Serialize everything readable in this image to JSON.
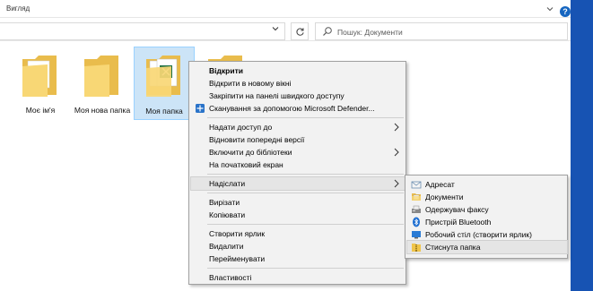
{
  "ribbon": {
    "tab_view": "Вигляд",
    "collapse_icon": "chevron-down-icon",
    "help_label": "?"
  },
  "address_bar": {
    "search_placeholder": "Пошук: Документи"
  },
  "folders": [
    {
      "label": "Моє ім'я",
      "selected": false
    },
    {
      "label": "Моя нова папка",
      "selected": false
    },
    {
      "label": "Моя папка",
      "selected": true
    },
    {
      "label": "",
      "selected": false
    }
  ],
  "context_menu": {
    "items": [
      {
        "label": "Відкрити",
        "bold": true
      },
      {
        "label": "Відкрити в новому вікні"
      },
      {
        "label": "Закріпити на панелі швидкого доступу"
      },
      {
        "label": "Сканування за допомогою Microsoft Defender...",
        "icon": "defender-icon"
      },
      {
        "label": "Надати доступ до",
        "submenu": true
      },
      {
        "label": "Відновити попередні версії"
      },
      {
        "label": "Включити до бібліотеки",
        "submenu": true
      },
      {
        "label": "На початковий екран"
      },
      {
        "label": "Надіслати",
        "submenu": true,
        "hover": true
      },
      {
        "label": "Вирізати"
      },
      {
        "label": "Копіювати"
      },
      {
        "label": "Створити ярлик"
      },
      {
        "label": "Видалити"
      },
      {
        "label": "Перейменувати"
      },
      {
        "label": "Властивості"
      }
    ]
  },
  "send_to_menu": {
    "items": [
      {
        "label": "Адресат",
        "icon": "mail-recipient-icon"
      },
      {
        "label": "Документи",
        "icon": "documents-icon"
      },
      {
        "label": "Одержувач факсу",
        "icon": "fax-icon"
      },
      {
        "label": "Пристрій Bluetooth",
        "icon": "bluetooth-icon"
      },
      {
        "label": "Робочий стіл (створити ярлик)",
        "icon": "desktop-icon"
      },
      {
        "label": "Стиснута папка",
        "icon": "zip-folder-icon",
        "hover": true
      }
    ]
  },
  "colors": {
    "accent": "#1753b3",
    "selection": "#cce4f7",
    "menu_bg": "#f2f2f2",
    "folder": "#f8d775"
  }
}
